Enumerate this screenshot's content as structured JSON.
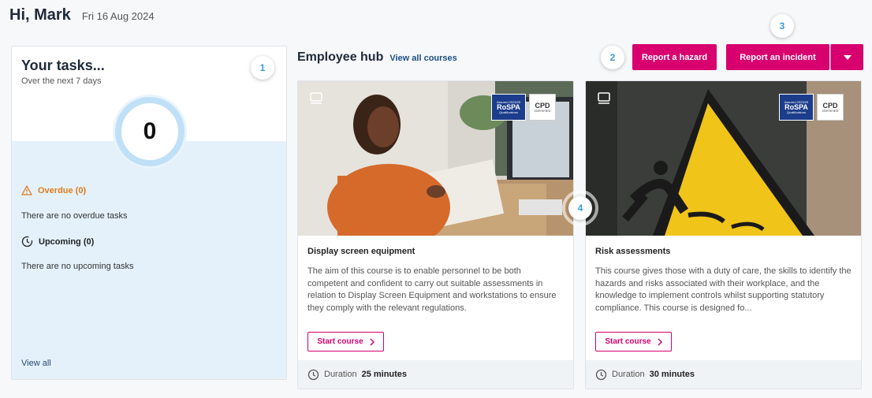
{
  "header": {
    "greeting": "Hi, Mark",
    "date": "Fri 16 Aug 2024"
  },
  "tasks": {
    "title": "Your tasks...",
    "subtitle": "Over the next 7 days",
    "count": "0",
    "overdue_label": "Overdue (0)",
    "overdue_msg": "There are no overdue tasks",
    "upcoming_label": "Upcoming (0)",
    "upcoming_msg": "There are no upcoming tasks",
    "view_all": "View all"
  },
  "hub": {
    "title": "Employee hub",
    "view_all_courses": "View all courses"
  },
  "actions": {
    "report_hazard": "Report a hazard",
    "report_incident": "Report an incident"
  },
  "badges": [
    "1",
    "2",
    "3",
    "4"
  ],
  "logos": {
    "rospa_small": "Assured 2023/25",
    "rospa": "RoSPA",
    "rospa_sub": "Qualifications",
    "cpd": "CPD",
    "cpd_sub": "CERTIFIED"
  },
  "courses": [
    {
      "title": "Display screen equipment",
      "description": "The aim of this course is to enable personnel to be both competent and confident to carry out suitable assessments in relation to Display Screen Equipment and workstations to ensure they comply with the relevant regulations.",
      "start_label": "Start course",
      "duration_label": "Duration",
      "duration": "25 minutes"
    },
    {
      "title": "Risk assessments",
      "description": "This course gives those with a duty of care, the skills to identify the hazards and risks associated with their workplace, and the knowledge to implement controls whilst supporting statutory compliance. This course is designed fo...",
      "start_label": "Start course",
      "duration_label": "Duration",
      "duration": "30 minutes"
    }
  ],
  "colors": {
    "accent": "#d8006e",
    "badge_text": "#3b9ad6",
    "overdue": "#e07b18",
    "panel": "#e4f1fb"
  }
}
